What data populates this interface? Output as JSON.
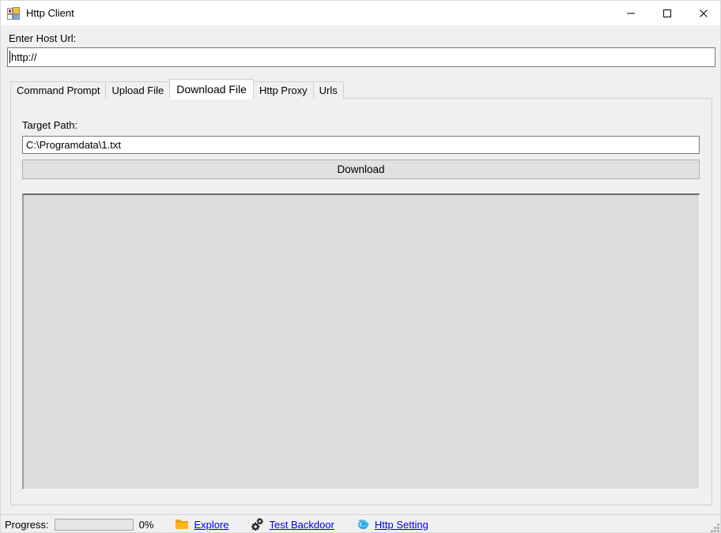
{
  "window": {
    "title": "Http Client",
    "icon": "winforms-app-icon",
    "caption_buttons": [
      {
        "name": "minimize",
        "glyph": "minimize-icon"
      },
      {
        "name": "maximize",
        "glyph": "maximize-icon"
      },
      {
        "name": "close",
        "glyph": "close-icon"
      }
    ]
  },
  "host": {
    "label": "Enter Host Url:",
    "value": "http://",
    "placeholder": ""
  },
  "tabs": [
    {
      "label": "Command Prompt",
      "active": false
    },
    {
      "label": "Upload File",
      "active": false
    },
    {
      "label": "Download File",
      "active": true
    },
    {
      "label": "Http Proxy",
      "active": false
    },
    {
      "label": "Urls",
      "active": false
    }
  ],
  "download_tab": {
    "target_label": "Target Path:",
    "target_value": "C:\\Programdata\\1.txt",
    "target_placeholder": "",
    "download_button": "Download",
    "output_text": ""
  },
  "statusbar": {
    "progress_label": "Progress:",
    "progress_percent": "0%",
    "progress_value": 0,
    "links": [
      {
        "icon": "folder-icon",
        "label": "Explore"
      },
      {
        "icon": "gears-icon",
        "label": "Test Backdoor"
      },
      {
        "icon": "internet-explorer-icon",
        "label": "Http Setting"
      }
    ]
  },
  "colors": {
    "window_bg": "#f0f0f0",
    "titlebar_bg": "#ffffff",
    "link": "#0000ee",
    "button_face": "#e1e1e1",
    "panel_inset": "#dcdcdc",
    "folder_icon": "#ffb515",
    "ie_icon": "#1e90e0"
  }
}
